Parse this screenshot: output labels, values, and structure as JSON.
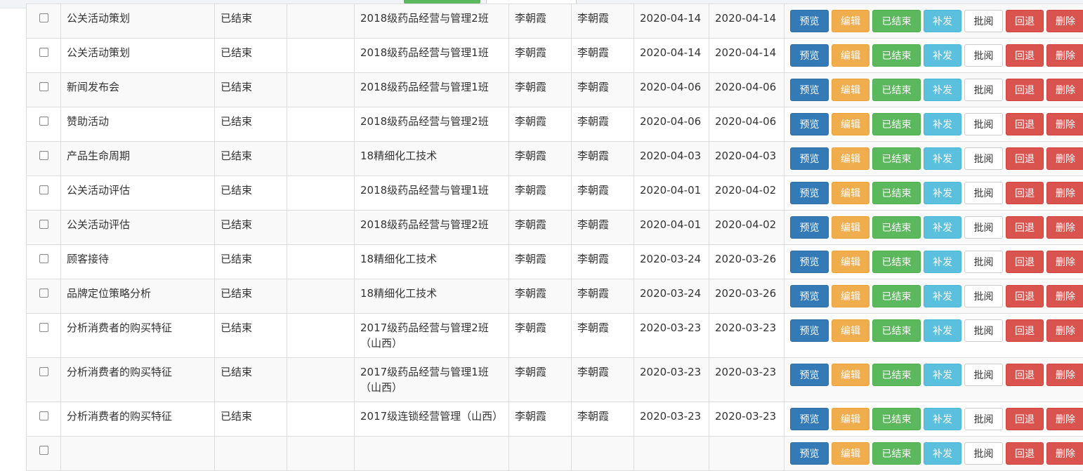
{
  "buttons": {
    "preview": "预览",
    "edit": "编辑",
    "done": "已结束",
    "resend": "补发",
    "review": "批阅",
    "back": "回退",
    "delete": "删除"
  },
  "rows": [
    {
      "name": "公关活动策划",
      "status": "已结束",
      "extra": "",
      "class_name": "2018级药品经营与管理2班",
      "teacher": "李朝霞",
      "creator": "李朝霞",
      "start": "2020-04-14",
      "end": "2020-04-14"
    },
    {
      "name": "公关活动策划",
      "status": "已结束",
      "extra": "",
      "class_name": "2018级药品经营与管理1班",
      "teacher": "李朝霞",
      "creator": "李朝霞",
      "start": "2020-04-14",
      "end": "2020-04-14"
    },
    {
      "name": "新闻发布会",
      "status": "已结束",
      "extra": "",
      "class_name": "2018级药品经营与管理1班",
      "teacher": "李朝霞",
      "creator": "李朝霞",
      "start": "2020-04-06",
      "end": "2020-04-06"
    },
    {
      "name": "赞助活动",
      "status": "已结束",
      "extra": "",
      "class_name": "2018级药品经营与管理2班",
      "teacher": "李朝霞",
      "creator": "李朝霞",
      "start": "2020-04-06",
      "end": "2020-04-06"
    },
    {
      "name": "产品生命周期",
      "status": "已结束",
      "extra": "",
      "class_name": "18精细化工技术",
      "teacher": "李朝霞",
      "creator": "李朝霞",
      "start": "2020-04-03",
      "end": "2020-04-03"
    },
    {
      "name": "公关活动评估",
      "status": "已结束",
      "extra": "",
      "class_name": "2018级药品经营与管理1班",
      "teacher": "李朝霞",
      "creator": "李朝霞",
      "start": "2020-04-01",
      "end": "2020-04-02"
    },
    {
      "name": "公关活动评估",
      "status": "已结束",
      "extra": "",
      "class_name": "2018级药品经营与管理2班",
      "teacher": "李朝霞",
      "creator": "李朝霞",
      "start": "2020-04-01",
      "end": "2020-04-02"
    },
    {
      "name": "顾客接待",
      "status": "已结束",
      "extra": "",
      "class_name": "18精细化工技术",
      "teacher": "李朝霞",
      "creator": "李朝霞",
      "start": "2020-03-24",
      "end": "2020-03-26"
    },
    {
      "name": "品牌定位策略分析",
      "status": "已结束",
      "extra": "",
      "class_name": "18精细化工技术",
      "teacher": "李朝霞",
      "creator": "李朝霞",
      "start": "2020-03-24",
      "end": "2020-03-26"
    },
    {
      "name": "分析消费者的购买特征",
      "status": "已结束",
      "extra": "",
      "class_name": "2017级药品经营与管理2班（山西）",
      "teacher": "李朝霞",
      "creator": "李朝霞",
      "start": "2020-03-23",
      "end": "2020-03-23"
    },
    {
      "name": "分析消费者的购买特征",
      "status": "已结束",
      "extra": "",
      "class_name": "2017级药品经营与管理1班（山西）",
      "teacher": "李朝霞",
      "creator": "李朝霞",
      "start": "2020-03-23",
      "end": "2020-03-23"
    },
    {
      "name": "分析消费者的购买特征",
      "status": "已结束",
      "extra": "",
      "class_name": "2017级连锁经营管理（山西）",
      "teacher": "李朝霞",
      "creator": "李朝霞",
      "start": "2020-03-23",
      "end": "2020-03-23"
    },
    {
      "name": "",
      "status": "",
      "extra": "",
      "class_name": "",
      "teacher": "",
      "creator": "",
      "start": "",
      "end": ""
    }
  ]
}
